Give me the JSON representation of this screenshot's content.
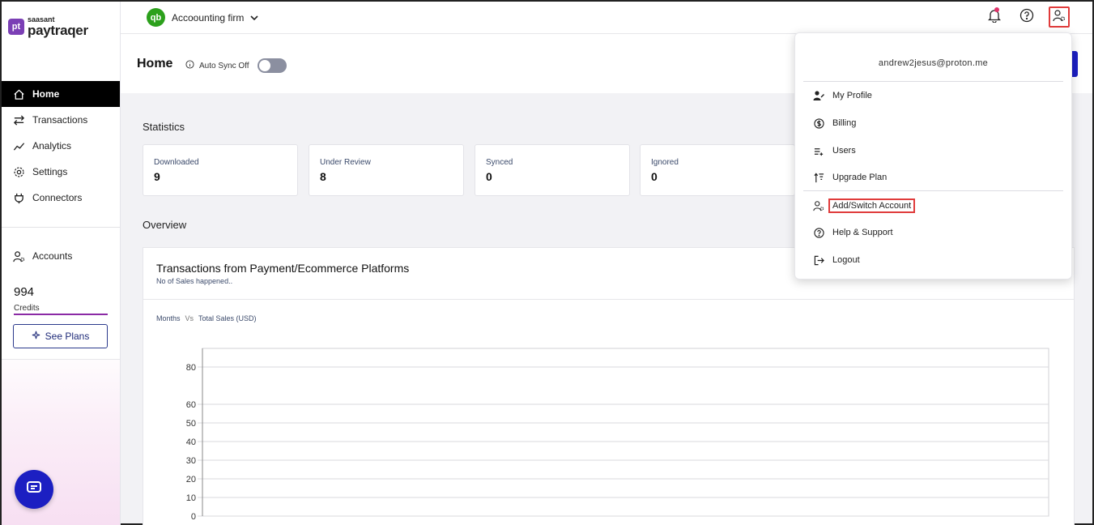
{
  "logo": {
    "small": "saasant",
    "big": "paytraqer",
    "mark": "pt"
  },
  "sidebar": {
    "items": [
      {
        "label": "Home",
        "icon": "home-icon",
        "active": true
      },
      {
        "label": "Transactions",
        "icon": "arrows-icon"
      },
      {
        "label": "Analytics",
        "icon": "chart-line-icon"
      },
      {
        "label": "Settings",
        "icon": "gear-icon"
      },
      {
        "label": "Connectors",
        "icon": "plug-icon"
      }
    ],
    "accounts_label": "Accounts",
    "credits_value": "994",
    "credits_label": "Credits",
    "see_plans_label": "See Plans"
  },
  "topbar": {
    "company_logo": "qb",
    "company_name": "Accoounting firm"
  },
  "page": {
    "title": "Home",
    "autosync_label": "Auto Sync Off"
  },
  "statistics": {
    "title": "Statistics",
    "cards": [
      {
        "label": "Downloaded",
        "value": "9"
      },
      {
        "label": "Under Review",
        "value": "8"
      },
      {
        "label": "Synced",
        "value": "0"
      },
      {
        "label": "Ignored",
        "value": "0"
      }
    ]
  },
  "overview": {
    "title": "Overview",
    "chart_title": "Transactions from Payment/Ecommerce Platforms",
    "chart_subtitle": "No of Sales happened..",
    "x_label": "Months",
    "vs": "Vs",
    "y_label": "Total Sales (USD)"
  },
  "chart_data": {
    "type": "bar",
    "categories": [],
    "values": [],
    "ylabel": "",
    "yticks": [
      0,
      10,
      20,
      30,
      40,
      50,
      60,
      80
    ],
    "ylim": [
      0,
      90
    ],
    "grid": true
  },
  "dropdown": {
    "email": "andrew2jesus@proton.me",
    "items": [
      {
        "label": "My Profile",
        "icon": "user-edit-icon"
      },
      {
        "label": "Billing",
        "icon": "dollar-circle-icon"
      },
      {
        "label": "Users",
        "icon": "users-list-icon"
      },
      {
        "label": "Upgrade Plan",
        "icon": "upgrade-icon"
      },
      {
        "label": "Add/Switch Account",
        "icon": "user-gear-icon"
      },
      {
        "label": "Help & Support",
        "icon": "help-circle-icon"
      },
      {
        "label": "Logout",
        "icon": "logout-icon"
      }
    ]
  }
}
